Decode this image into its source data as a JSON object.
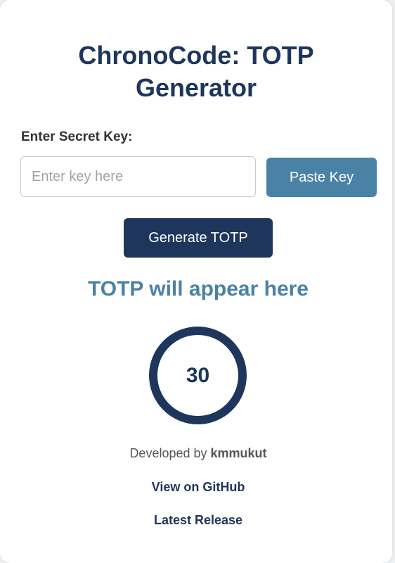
{
  "header": {
    "title_line1": "ChronoCode: TOTP",
    "title_line2": "Generator"
  },
  "form": {
    "secret_label": "Enter Secret Key:",
    "secret_value": "",
    "secret_placeholder": "Enter key here",
    "paste_button": "Paste Key",
    "generate_button": "Generate TOTP"
  },
  "result": {
    "totp_text": "TOTP will appear here",
    "timer_seconds": "30"
  },
  "footer": {
    "developed_by": "Developed by",
    "author": "kmmukut",
    "github_link": "View on GitHub",
    "release_link": "Latest Release"
  },
  "colors": {
    "primary": "#1e365c",
    "accent": "#4a82a6",
    "background": "#ffffff"
  }
}
